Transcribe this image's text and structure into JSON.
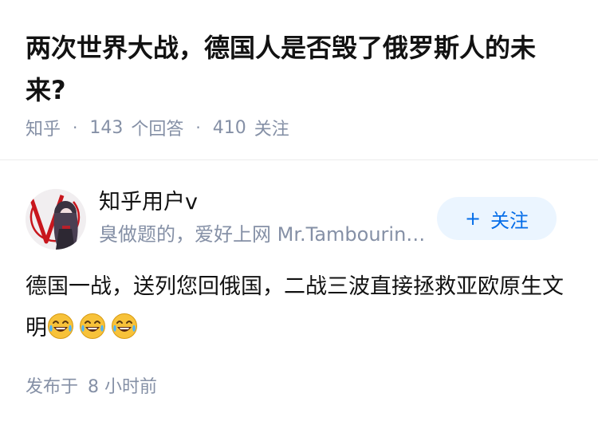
{
  "question": {
    "title": "两次世界大战，德国人是否毁了俄罗斯人的未来?",
    "source": "知乎",
    "answers_count": "143",
    "answers_label": "个回答",
    "followers_count": "410",
    "followers_label": "关注"
  },
  "author": {
    "name": "知乎用户v",
    "bio": "臭做题的，爱好上网 Mr.Tambourine Man"
  },
  "follow_button": {
    "icon": "plus-icon",
    "label": "关注"
  },
  "answer": {
    "text": "德国一战，送列您回俄国，二战三波直接拯救亚欧原生文明",
    "emojis": [
      "laughing-tears-icon",
      "laughing-tears-icon",
      "laughing-tears-icon"
    ],
    "posted_label": "发布于",
    "posted_time": "8 小时前"
  },
  "colors": {
    "accent": "#056de8",
    "follow_bg": "#ebf5ff",
    "muted_text": "#8590a6",
    "emoji_yellow": "#f7c23a"
  }
}
